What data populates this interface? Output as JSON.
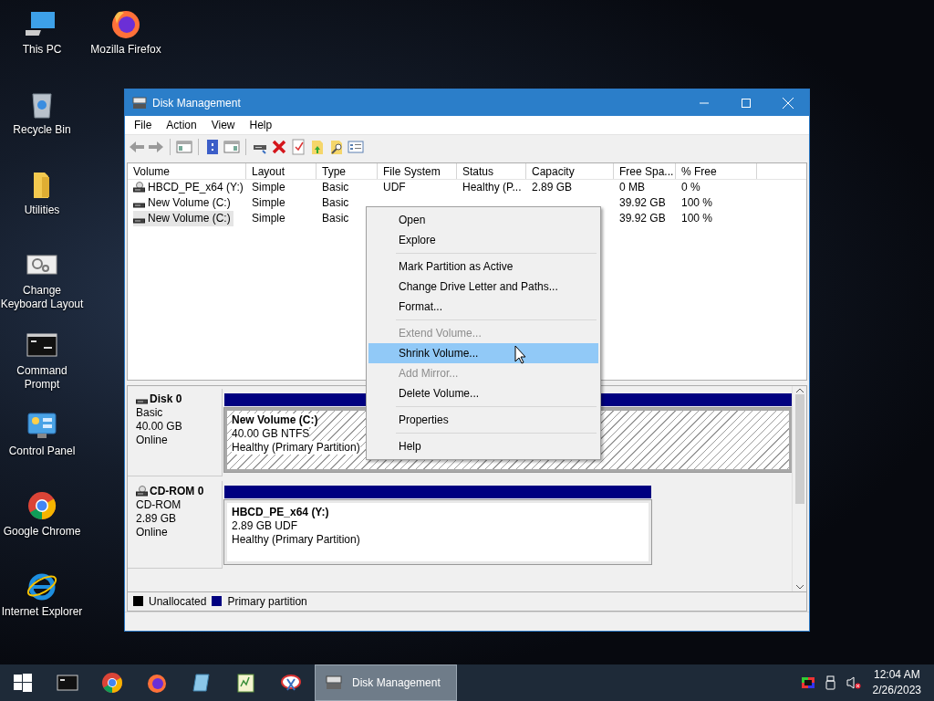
{
  "desktop": {
    "columns": [
      [
        {
          "label": "This PC",
          "kind": "pc"
        },
        {
          "label": "Recycle Bin",
          "kind": "recycle"
        },
        {
          "label": "Utilities",
          "kind": "folder"
        },
        {
          "label": "Change Keyboard Layout",
          "kind": "settings"
        },
        {
          "label": "Command Prompt",
          "kind": "cmd"
        },
        {
          "label": "Control Panel",
          "kind": "control"
        },
        {
          "label": "Google Chrome",
          "kind": "chrome"
        },
        {
          "label": "Internet Explorer",
          "kind": "ie"
        }
      ],
      [
        {
          "label": "Mozilla Firefox",
          "kind": "firefox"
        }
      ]
    ]
  },
  "window": {
    "title": "Disk Management",
    "menu": [
      "File",
      "Action",
      "View",
      "Help"
    ],
    "toolbar": [
      {
        "kind": "back"
      },
      {
        "kind": "forward"
      },
      {
        "kind": "separator"
      },
      {
        "kind": "tree"
      },
      {
        "kind": "separator"
      },
      {
        "kind": "help"
      },
      {
        "kind": "panel"
      },
      {
        "kind": "separator"
      },
      {
        "kind": "drive"
      },
      {
        "kind": "delete"
      },
      {
        "kind": "check"
      },
      {
        "kind": "folder-up"
      },
      {
        "kind": "folder-search"
      },
      {
        "kind": "list"
      }
    ],
    "table": {
      "columns": [
        "Volume",
        "Layout",
        "Type",
        "File System",
        "Status",
        "Capacity",
        "Free Spa...",
        "% Free"
      ],
      "rows": [
        {
          "kind": "cd",
          "selected": false,
          "cells": [
            "HBCD_PE_x64 (Y:)",
            "Simple",
            "Basic",
            "UDF",
            "Healthy (P...",
            "2.89 GB",
            "0 MB",
            "0 %"
          ]
        },
        {
          "kind": "disk",
          "selected": false,
          "cells": [
            "New Volume (C:)",
            "Simple",
            "Basic",
            null,
            null,
            null,
            "39.92 GB",
            "100 %"
          ]
        },
        {
          "kind": "disk",
          "selected": true,
          "cells": [
            "New Volume (C:)",
            "Simple",
            "Basic",
            null,
            null,
            null,
            "39.92 GB",
            "100 %"
          ]
        }
      ]
    },
    "disks": [
      {
        "kind": "disk",
        "name": "Disk 0",
        "type": "Basic",
        "size": "40.00 GB",
        "status": "Online",
        "partitions": [
          {
            "name": "New Volume  (C:)",
            "detail": "40.00 GB NTFS",
            "status": "Healthy (Primary Partition)",
            "selected": true
          }
        ]
      },
      {
        "kind": "cd",
        "name": "CD-ROM 0",
        "type": "CD-ROM",
        "size": "2.89 GB",
        "status": "Online",
        "partitions": [
          {
            "name": "HBCD_PE_x64  (Y:)",
            "detail": "2.89 GB UDF",
            "status": "Healthy (Primary Partition)",
            "selected": false
          }
        ]
      }
    ],
    "legend": [
      {
        "label": "Unallocated",
        "color": "#000000"
      },
      {
        "label": "Primary partition",
        "color": "#000080"
      }
    ]
  },
  "context_menu": [
    {
      "kind": "item",
      "label": "Open",
      "disabled": false,
      "selected": false
    },
    {
      "kind": "item",
      "label": "Explore",
      "disabled": false,
      "selected": false
    },
    {
      "kind": "separator"
    },
    {
      "kind": "item",
      "label": "Mark Partition as Active",
      "disabled": false,
      "selected": false
    },
    {
      "kind": "item",
      "label": "Change Drive Letter and Paths...",
      "disabled": false,
      "selected": false
    },
    {
      "kind": "item",
      "label": "Format...",
      "disabled": false,
      "selected": false
    },
    {
      "kind": "separator"
    },
    {
      "kind": "item",
      "label": "Extend Volume...",
      "disabled": true,
      "selected": false
    },
    {
      "kind": "item",
      "label": "Shrink Volume...",
      "disabled": false,
      "selected": true
    },
    {
      "kind": "item",
      "label": "Add Mirror...",
      "disabled": true,
      "selected": false
    },
    {
      "kind": "item",
      "label": "Delete Volume...",
      "disabled": false,
      "selected": false
    },
    {
      "kind": "separator"
    },
    {
      "kind": "item",
      "label": "Properties",
      "disabled": false,
      "selected": false
    },
    {
      "kind": "separator"
    },
    {
      "kind": "item",
      "label": "Help",
      "disabled": false,
      "selected": false
    }
  ],
  "taskbar": {
    "pinned": [
      {
        "kind": "cmd"
      },
      {
        "kind": "chrome"
      },
      {
        "kind": "firefox"
      },
      {
        "kind": "book"
      },
      {
        "kind": "notepad"
      },
      {
        "kind": "snip"
      }
    ],
    "windows": [
      {
        "label": "Disk Management",
        "selected": true
      }
    ],
    "tray": [
      {
        "kind": "color"
      },
      {
        "kind": "usb"
      },
      {
        "kind": "muted"
      }
    ],
    "time": "12:04 AM",
    "date": "2/26/2023"
  }
}
